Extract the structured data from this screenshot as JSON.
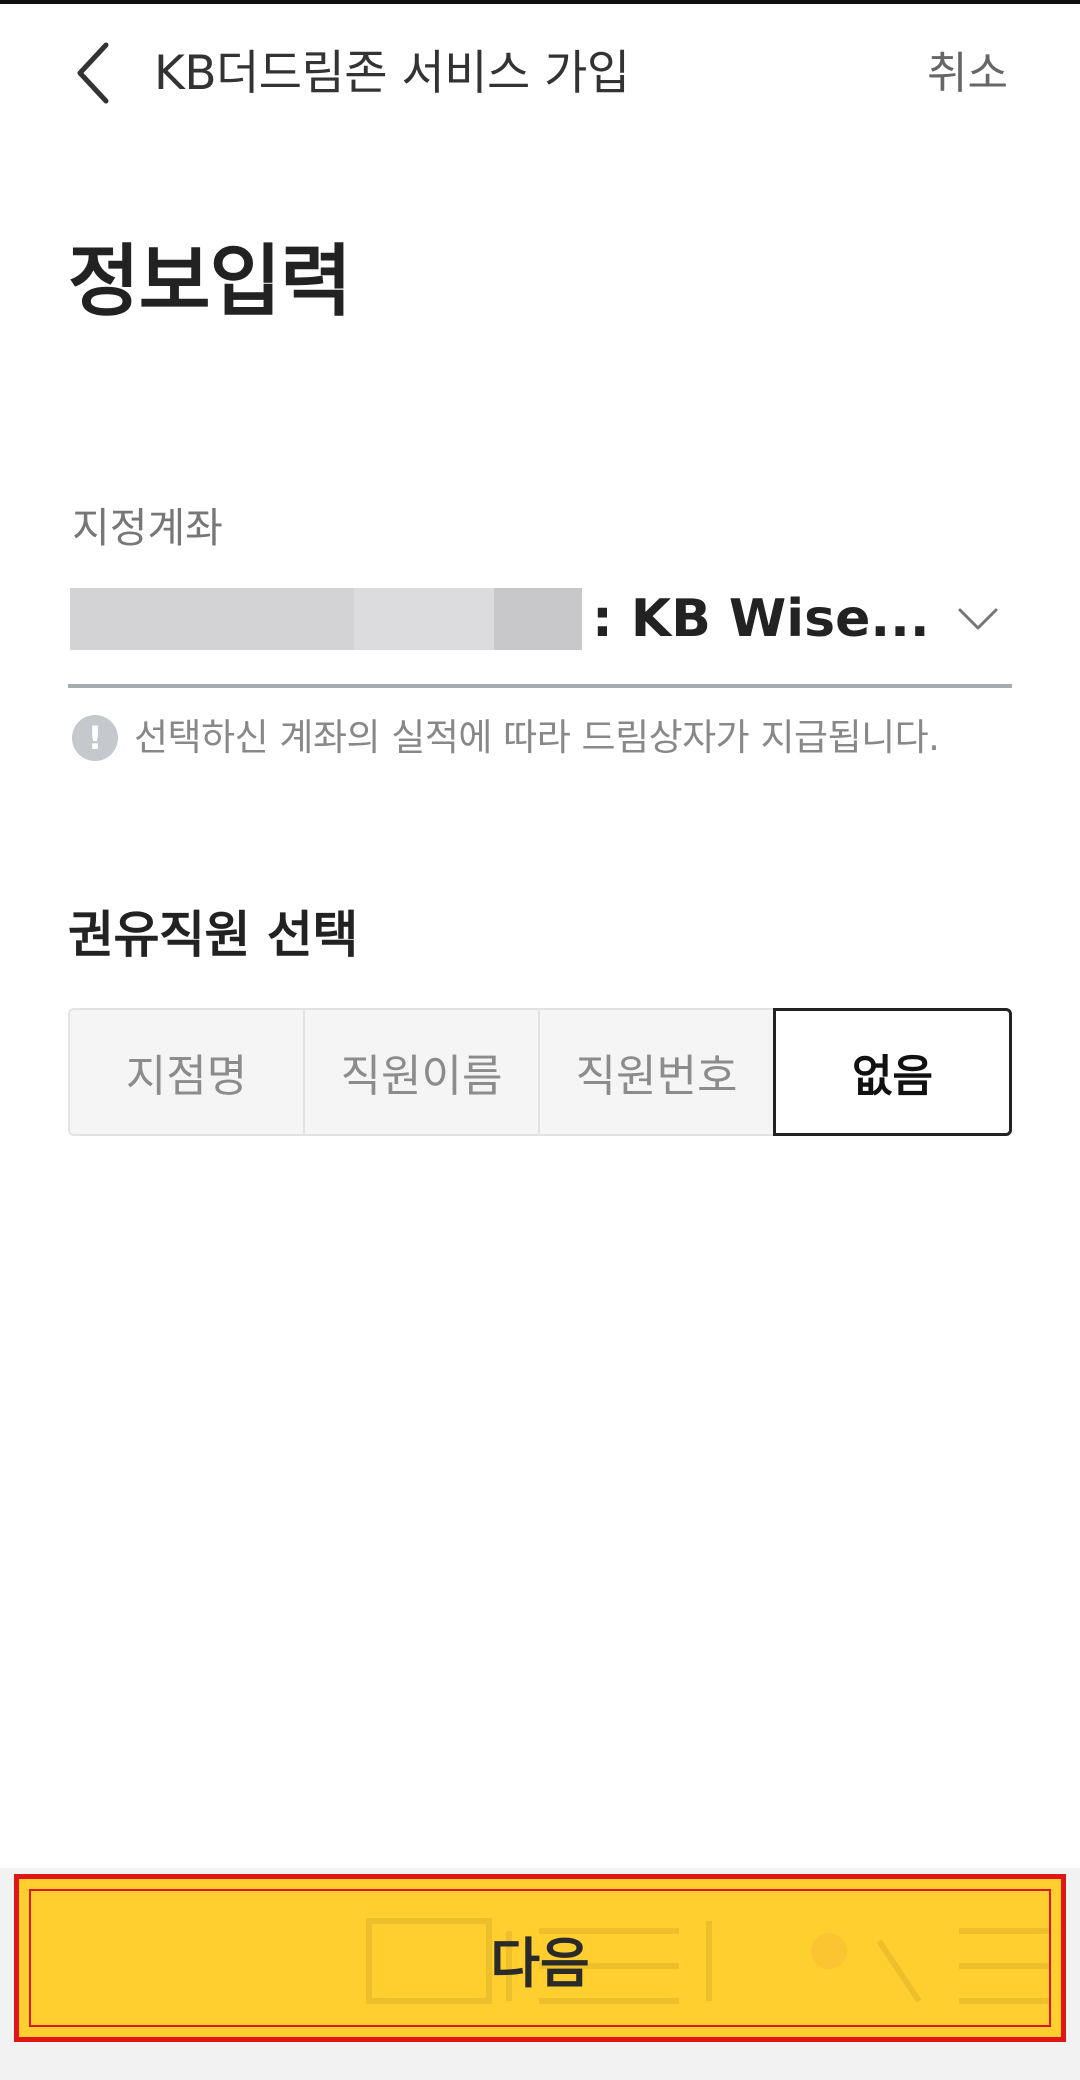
{
  "header": {
    "title": "KB더드림존 서비스 가입",
    "cancel_label": "취소"
  },
  "page_title": "정보입력",
  "account": {
    "label": "지정계좌",
    "name": ": KB Wise...",
    "notice": "선택하신 계좌의 실적에 따라 드림상자가 지급됩니다."
  },
  "employee": {
    "title": "권유직원 선택",
    "options": [
      "지점명",
      "직원이름",
      "직원번호",
      "없음"
    ],
    "selected": "없음"
  },
  "next_button": {
    "label": "다음"
  },
  "colors": {
    "accent_yellow": "#fecf2f",
    "highlight_red": "#e01515"
  }
}
